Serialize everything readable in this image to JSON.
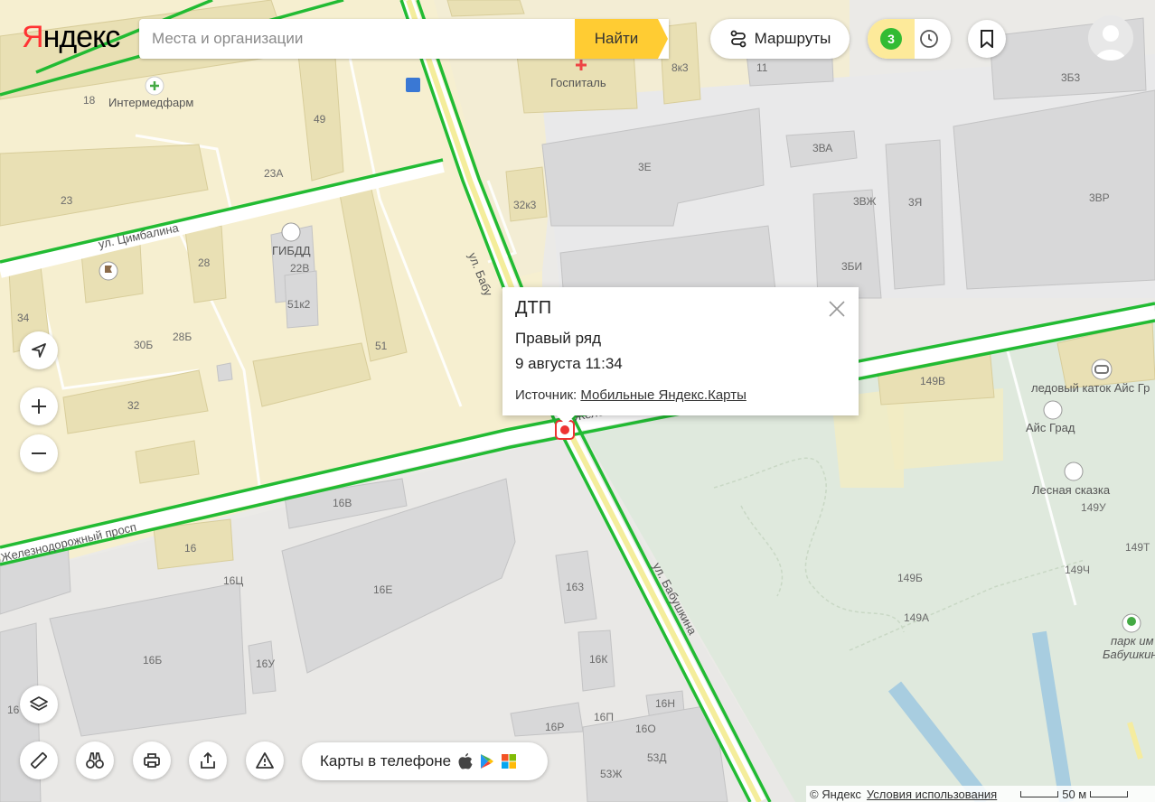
{
  "header": {
    "logo": "Яндекс",
    "search_placeholder": "Места и организации",
    "search_button": "Найти",
    "routes_label": "Маршруты",
    "traffic_level": "3"
  },
  "incident_popup": {
    "title": "ДТП",
    "lane": "Правый ряд",
    "datetime": "9 августа 11:34",
    "source_label": "Источник:",
    "source_link": "Мобильные Яндекс.Карты"
  },
  "bottom": {
    "apps_label": "Карты в телефоне"
  },
  "footer": {
    "copyright": "© Яндекс",
    "terms_link": "Условия использования",
    "scale_label": "50 м"
  },
  "map_labels": {
    "intermedfarm": "Интермедфарм",
    "gospital": "Госпиталь",
    "gibdd": "ГИБДД",
    "katok": "ледовый каток Айс Гр",
    "aisgrad": "Айс Град",
    "lesnaya": "Лесная сказка",
    "park": "парк им",
    "park2": "Бабушкин",
    "ul_tsimbalina": "ул. Цимбалина",
    "ul_babushkina_n": "ул. Бабу",
    "ul_babushkina_s": "ул. Бабушкина",
    "zhd_prosp": "Железнодорожный просп",
    "zhd_short": "Железнод",
    "houses": [
      "18",
      "49",
      "23А",
      "23",
      "28",
      "22В",
      "51к2",
      "34",
      "30Б",
      "28Б",
      "51",
      "32",
      "16В",
      "16",
      "16Ц",
      "16Е",
      "16Б",
      "16У",
      "163",
      "16К",
      "16Н",
      "16П",
      "16Р",
      "16О",
      "53Д",
      "53Ж",
      "16",
      "8к3",
      "11",
      "3Б3",
      "3Е",
      "3ВА",
      "32к3",
      "3ВЖ",
      "3Я",
      "3ВР",
      "3БИ",
      "149В",
      "149У",
      "149Т",
      "149Б",
      "149Ч",
      "149А"
    ]
  },
  "colors": {
    "traffic_green": "#22bb33",
    "accent_yellow": "#ffcc33",
    "residential": "#f5efd0",
    "industrial": "#e7e6e6",
    "park": "#dfeadd"
  }
}
